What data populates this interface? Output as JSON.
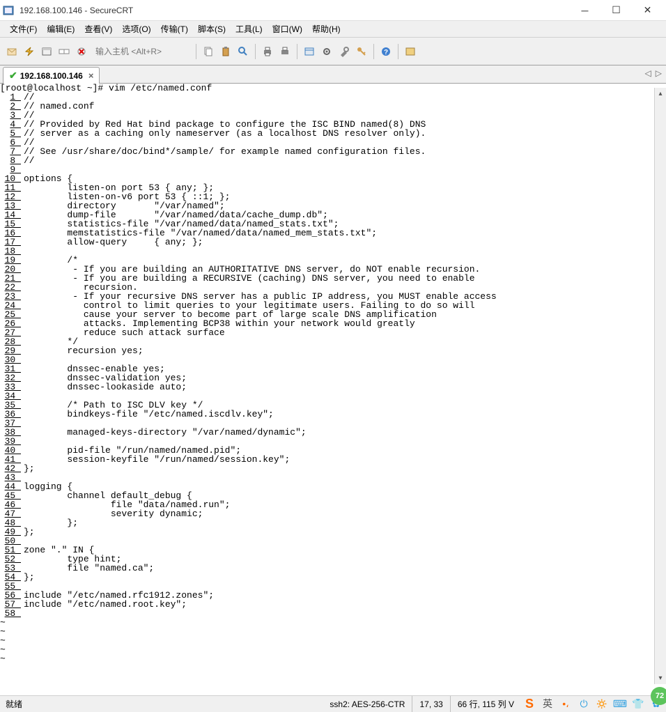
{
  "window": {
    "title": "192.168.100.146 - SecureCRT"
  },
  "menus": [
    "文件(F)",
    "编辑(E)",
    "查看(V)",
    "选项(O)",
    "传输(T)",
    "脚本(S)",
    "工具(L)",
    "窗口(W)",
    "帮助(H)"
  ],
  "toolbar": {
    "host_placeholder": "输入主机 <Alt+R>"
  },
  "tab": {
    "label": "192.168.100.146"
  },
  "prompt": "[root@localhost ~]# vim /etc/named.conf",
  "lines": [
    "//",
    "// named.conf",
    "//",
    "// Provided by Red Hat bind package to configure the ISC BIND named(8) DNS",
    "// server as a caching only nameserver (as a localhost DNS resolver only).",
    "//",
    "// See /usr/share/doc/bind*/sample/ for example named configuration files.",
    "//",
    "",
    "options {",
    "        listen-on port 53 { any; };",
    "        listen-on-v6 port 53 { ::1; };",
    "        directory       \"/var/named\";",
    "        dump-file       \"/var/named/data/cache_dump.db\";",
    "        statistics-file \"/var/named/data/named_stats.txt\";",
    "        memstatistics-file \"/var/named/data/named_mem_stats.txt\";",
    "        allow-query     { any; };",
    "",
    "        /*",
    "         - If you are building an AUTHORITATIVE DNS server, do NOT enable recursion.",
    "         - If you are building a RECURSIVE (caching) DNS server, you need to enable",
    "           recursion.",
    "         - If your recursive DNS server has a public IP address, you MUST enable access",
    "           control to limit queries to your legitimate users. Failing to do so will",
    "           cause your server to become part of large scale DNS amplification",
    "           attacks. Implementing BCP38 within your network would greatly",
    "           reduce such attack surface",
    "        */",
    "        recursion yes;",
    "",
    "        dnssec-enable yes;",
    "        dnssec-validation yes;",
    "        dnssec-lookaside auto;",
    "",
    "        /* Path to ISC DLV key */",
    "        bindkeys-file \"/etc/named.iscdlv.key\";",
    "",
    "        managed-keys-directory \"/var/named/dynamic\";",
    "",
    "        pid-file \"/run/named/named.pid\";",
    "        session-keyfile \"/run/named/session.key\";",
    "};",
    "",
    "logging {",
    "        channel default_debug {",
    "                file \"data/named.run\";",
    "                severity dynamic;",
    "        };",
    "};",
    "",
    "zone \".\" IN {",
    "        type hint;",
    "        file \"named.ca\";",
    "};",
    "",
    "include \"/etc/named.rfc1912.zones\";",
    "include \"/etc/named.root.key\";",
    ""
  ],
  "status": {
    "ready": "就绪",
    "cipher": "ssh2: AES-256-CTR",
    "cursor": "17,  33",
    "dims": "66 行, 115 列 V",
    "badge": "72"
  },
  "tray": {
    "ime": "英"
  }
}
